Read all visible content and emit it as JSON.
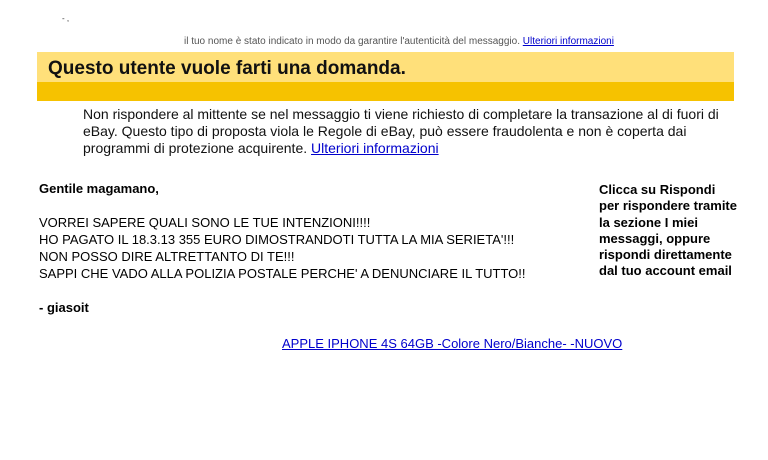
{
  "top": {
    "cut_text": "il tuo nome è stato indicato in modo da garantire l'autenticità del messaggio.",
    "cut_link": "Ulteriori informazioni",
    "corner_mark": "- ,"
  },
  "banner": {
    "title": "Questo utente vuole farti una domanda."
  },
  "warning": {
    "text": "Non rispondere al mittente se nel messaggio ti viene richiesto di completare la transazione al di fuori di eBay. Questo tipo di proposta viola le Regole di eBay, può essere fraudolenta e non è coperta dai programmi di protezione acquirente.",
    "link": "Ulteriori informazioni"
  },
  "message": {
    "greeting": "Gentile magamano,",
    "lines": [
      "VORREI SAPERE QUALI SONO LE TUE INTENZIONI!!!!",
      "HO PAGATO IL 18.3.13 355 EURO DIMOSTRANDOTI TUTTA LA MIA SERIETA'!!!",
      "NON POSSO DIRE ALTRETTANTO DI TE!!!",
      "SAPPI CHE VADO ALLA POLIZIA POSTALE PERCHE' A DENUNCIARE IL TUTTO!!"
    ],
    "signature": "- giasoit"
  },
  "sidebar": {
    "reply_hint": "Clicca su Rispondi per rispondere tramite la sezione I miei messaggi, oppure rispondi direttamente dal tuo account email"
  },
  "item": {
    "link": "APPLE IPHONE 4S 64GB -Colore Nero/Bianche- -NUOVO"
  },
  "colors": {
    "banner_light": "#ffe07a",
    "banner_strip": "#f6c200",
    "link": "#0000cc"
  }
}
